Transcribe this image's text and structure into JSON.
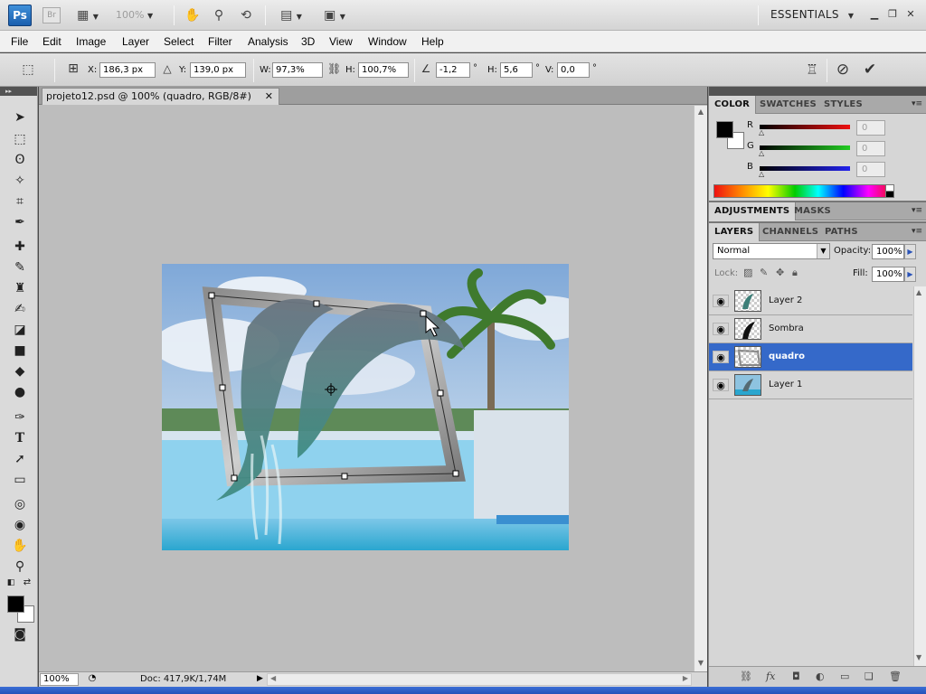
{
  "app": {
    "logo": "Ps",
    "bridge": "Br",
    "zoom": "100%",
    "workspace": "ESSENTIALS"
  },
  "menu": [
    "File",
    "Edit",
    "Image",
    "Layer",
    "Select",
    "Filter",
    "Analysis",
    "3D",
    "View",
    "Window",
    "Help"
  ],
  "options": {
    "x_label": "X:",
    "x_value": "186,3 px",
    "y_label": "Y:",
    "y_value": "139,0 px",
    "w_label": "W:",
    "w_value": "97,3%",
    "h_label": "H:",
    "h_value": "100,7%",
    "angle_value": "-1,2",
    "angle_unit": "°",
    "hskew_label": "H:",
    "hskew_value": "5,6",
    "vskew_label": "V:",
    "vskew_value": "0,0"
  },
  "document": {
    "tab_title": "projeto12.psd @ 100% (quadro, RGB/8#)",
    "zoom": "100%",
    "info": "Doc: 417,9K/1,74M"
  },
  "panels": {
    "color_tabs": [
      "COLOR",
      "SWATCHES",
      "STYLES"
    ],
    "r_label": "R",
    "g_label": "G",
    "b_label": "B",
    "r_value": "0",
    "g_value": "0",
    "b_value": "0",
    "adjust_tabs": [
      "ADJUSTMENTS",
      "MASKS"
    ],
    "layer_tabs": [
      "LAYERS",
      "CHANNELS",
      "PATHS"
    ],
    "blend_mode": "Normal",
    "opacity_label": "Opacity:",
    "opacity_value": "100%",
    "lock_label": "Lock:",
    "fill_label": "Fill:",
    "fill_value": "100%"
  },
  "layers": [
    {
      "name": "Layer 2",
      "selected": false
    },
    {
      "name": "Sombra",
      "selected": false
    },
    {
      "name": "quadro",
      "selected": true
    },
    {
      "name": "Layer 1",
      "selected": false
    }
  ],
  "colors": {
    "selection": "#3569c9",
    "panel_bg": "#d6d6d6",
    "canvas_bg": "#bdbdbd"
  }
}
